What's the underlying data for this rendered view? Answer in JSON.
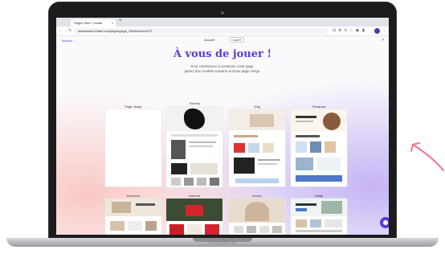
{
  "browser": {
    "tab_title": "Pages Web • Vivlab",
    "tab_close": "×",
    "new_tab": "+",
    "url": "dashboard.vivlab.com/pages/page_33e0f4d1a1e07f",
    "nav": {
      "back": "←",
      "forward": "→",
      "reload": "↻"
    },
    "ext": [
      "⊡",
      "⊕",
      "⊙",
      "☆",
      "◆",
      "▮",
      "⋮"
    ]
  },
  "app": {
    "back_link": "Tableau",
    "workspace": "Accueil",
    "language": "Lab ▾",
    "open_icon": "↗",
    "headline": "À vous de jouer !",
    "subtitle_line1": "Pour commencer à construire votre page,",
    "subtitle_line2": "partez d'un modèle existant ou d'une page vierge."
  },
  "templates": [
    {
      "label": "Page vierge"
    },
    {
      "label": "Sokolaj"
    },
    {
      "label": "Zelg"
    },
    {
      "label": "Roxanna"
    },
    {
      "label": "Eleonore"
    },
    {
      "label": "Andreia"
    },
    {
      "label": "Emryz"
    },
    {
      "label": "Kallig"
    }
  ],
  "laptop": {
    "model": "MacBook Air"
  },
  "colors": {
    "accent": "#5b3cd4",
    "arrow": "#f0748a"
  },
  "icons": {
    "chat": "chat-bubble-icon",
    "arrow": "curved-arrow-icon"
  }
}
